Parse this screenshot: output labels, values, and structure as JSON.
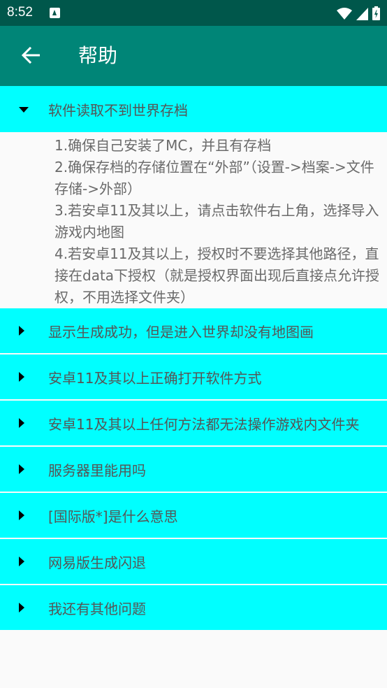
{
  "status_bar": {
    "time": "8:52",
    "icons": [
      "notification-a-icon",
      "wifi-icon",
      "signal-icon",
      "battery-icon"
    ]
  },
  "app_bar": {
    "title": "帮助",
    "back_icon": "arrow-back-icon"
  },
  "faq": {
    "expanded": {
      "title": "软件读取不到世界存档",
      "answer": [
        "1.确保自己安装了MC，并且有存档",
        "2.确保存档的存储位置在“外部”（设置->档案->文件存储->外部）",
        "3.若安卓11及其以上，请点击软件右上角，选择导入游戏内地图",
        "4.若安卓11及其以上，授权时不要选择其他路径，直接在data下授权（就是授权界面出现后直接点允许授权，不用选择文件夹）"
      ]
    },
    "items": [
      {
        "title": "显示生成成功，但是进入世界却没有地图画"
      },
      {
        "title": "安卓11及其以上正确打开软件方式"
      },
      {
        "title": "安卓11及其以上任何方法都无法操作游戏内文件夹"
      },
      {
        "title": "服务器里能用吗"
      },
      {
        "title": "[国际版*]是什么意思"
      },
      {
        "title": "网易版生成闪退"
      },
      {
        "title": "我还有其他问题"
      }
    ]
  },
  "colors": {
    "status_bar": "#00574b",
    "app_bar": "#008577",
    "header": "#00ffff",
    "background": "#fafafa"
  }
}
